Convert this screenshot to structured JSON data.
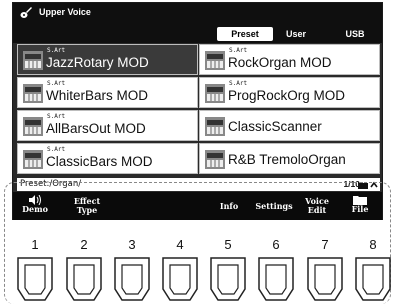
{
  "header": {
    "title": "Upper Voice",
    "tabs": [
      "Preset",
      "User",
      "USB"
    ],
    "active_tab": "Preset"
  },
  "voices": [
    {
      "sub": "S.Art",
      "name": "JazzRotary MOD",
      "selected": true
    },
    {
      "sub": "S.Art",
      "name": "RockOrgan MOD"
    },
    {
      "sub": "S.Art",
      "name": "WhiterBars MOD"
    },
    {
      "sub": "S.Art",
      "name": "ProgRockOrg MOD"
    },
    {
      "sub": "S.Art",
      "name": "AllBarsOut MOD"
    },
    {
      "sub": "",
      "name": "ClassicScanner"
    },
    {
      "sub": "S.Art",
      "name": "ClassicBars MOD"
    },
    {
      "sub": "",
      "name": "R&B TremoloOrgan"
    }
  ],
  "status": {
    "path": "Preset:/Organ/",
    "page": "1/10"
  },
  "function_bar": {
    "demo": "Demo",
    "effect_type_1": "Effect",
    "effect_type_2": "Type",
    "info": "Info",
    "settings": "Settings",
    "voice_edit_1": "Voice",
    "voice_edit_2": "Edit",
    "file": "File"
  },
  "panel_buttons": [
    "1",
    "2",
    "3",
    "4",
    "5",
    "6",
    "7",
    "8"
  ],
  "colors": {
    "screen_bg": "#2a2a2a",
    "header_bg": "#0f0f0f",
    "selected_voice_bg": "#3a3a3a"
  }
}
